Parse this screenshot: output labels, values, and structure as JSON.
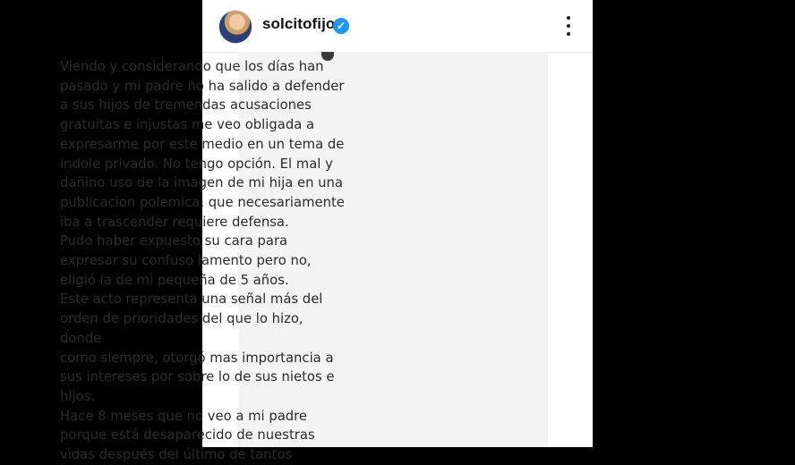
{
  "header": {
    "username": "solcitofijo",
    "verified_icon": "verified-badge-icon",
    "more_icon": "more-vertical-icon",
    "verified_color": "#1E96F0"
  },
  "post": {
    "paragraphs": [
      "Viendo y considerando que los días han\npasado y mi padre no ha salido a defender\na sus hijos de tremendas acusaciones\ngratuitas e injustas me veo obligada a\nexpresarme por este medio en un tema de\níndole privado. No tengo opción. El mal y\ndañino uso de la imagen de mi hija en una\npublicacion polemica, que necesariamente\niba a trascender requiere defensa.",
      "Pudo haber expuesto su cara para\nexpresar su confuso lamento pero no,\neligió la de mi pequeña de 5 años.",
      "Este acto representa una señal más del\norden de prioridades del que lo hizo, donde\ncomo siempre, otorgó mas importancia a\nsus intereses por sobre lo de sus nietos e\nhijos.",
      "Hace 8 meses que no veo a mi padre\nporque está desaparecido de nuestras\nvidas después del último de tantos"
    ]
  }
}
